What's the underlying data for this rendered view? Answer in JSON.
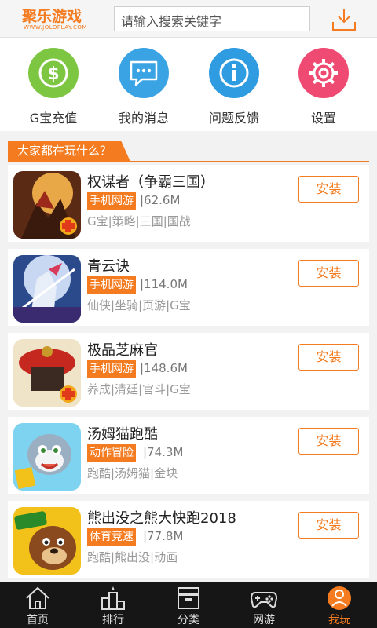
{
  "header": {
    "logo_text": "聚乐游戏",
    "logo_subtext": "WWW.JOLOPLAY.COM",
    "search_placeholder": "请输入搜索关键字",
    "download_icon": "download-tray-icon"
  },
  "quick_actions": [
    {
      "label": "G宝充值",
      "icon": "dollar-icon",
      "color": "#7dc642"
    },
    {
      "label": "我的消息",
      "icon": "message-icon",
      "color": "#3aa3e3"
    },
    {
      "label": "问题反馈",
      "icon": "info-icon",
      "color": "#2f9be0"
    },
    {
      "label": "设置",
      "icon": "gear-icon",
      "color": "#ef4a72"
    }
  ],
  "section": {
    "title": "大家都在玩什么？"
  },
  "games": [
    {
      "name": "权谋者（争霸三国）",
      "category": "手机网游",
      "size": "|62.6M",
      "tags": "G宝|策略|三国|国战",
      "install": "安装"
    },
    {
      "name": "青云诀",
      "category": "手机网游",
      "size": "|114.0M",
      "tags": "仙侠|坐骑|页游|G宝",
      "install": "安装"
    },
    {
      "name": "极品芝麻官",
      "category": "手机网游",
      "size": "|148.6M",
      "tags": "养成|清廷|官斗|G宝",
      "install": "安装"
    },
    {
      "name": "汤姆猫跑酷",
      "category": "动作冒险",
      "size": "|74.3M",
      "tags": "跑酷|汤姆猫|金块",
      "install": "安装"
    },
    {
      "name": "熊出没之熊大快跑2018",
      "category": "体育竞速",
      "size": "|77.8M",
      "tags": "跑酷|熊出没|动画",
      "install": "安装"
    }
  ],
  "nav": [
    {
      "label": "首页",
      "icon": "home-icon"
    },
    {
      "label": "排行",
      "icon": "ranking-icon"
    },
    {
      "label": "分类",
      "icon": "category-box-icon"
    },
    {
      "label": "网游",
      "icon": "gamepad-icon"
    },
    {
      "label": "我玩",
      "icon": "user-icon",
      "active": true
    }
  ],
  "colors": {
    "accent": "#f47b20",
    "nav_bg": "#161616"
  }
}
